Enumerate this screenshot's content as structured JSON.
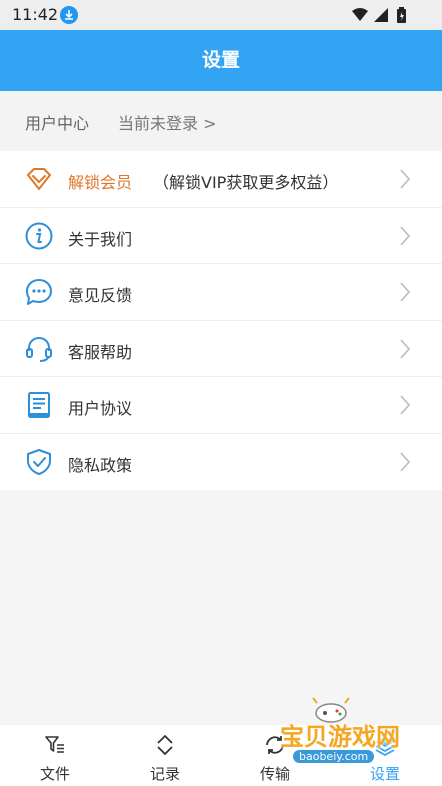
{
  "status_bar": {
    "time": "11:42"
  },
  "header": {
    "title": "设置"
  },
  "user": {
    "label": "用户中心",
    "login_link": "当前未登录 >"
  },
  "menu": [
    {
      "label": "解锁会员",
      "sub": "（解锁VIP获取更多权益）"
    },
    {
      "label": "关于我们"
    },
    {
      "label": "意见反馈"
    },
    {
      "label": "客服帮助"
    },
    {
      "label": "用户协议"
    },
    {
      "label": "隐私政策"
    }
  ],
  "tabs": [
    {
      "label": "文件"
    },
    {
      "label": "记录"
    },
    {
      "label": "传输"
    },
    {
      "label": "设置",
      "active": true
    }
  ],
  "watermark": {
    "text": "宝贝游戏网",
    "url": "baobeiy.com"
  },
  "colors": {
    "accent": "#33a3f4",
    "vip": "#e0782a",
    "icon_blue": "#2f8ed8"
  }
}
